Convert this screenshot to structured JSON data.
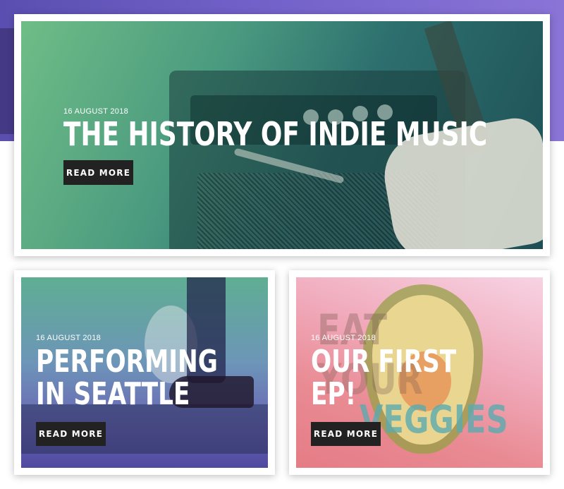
{
  "featured_post": {
    "date": "16 AUGUST 2018",
    "title": "THE HISTORY OF INDIE MUSIC",
    "button_label": "READ MORE"
  },
  "posts": [
    {
      "date": "16 AUGUST 2018",
      "title_line1": "PERFORMING",
      "title_line2": "IN SEATTLE",
      "button_label": "READ MORE"
    },
    {
      "date": "16 AUGUST 2018",
      "title_line1": "OUR FIRST",
      "title_line2": "EP!",
      "button_label": "READ MORE",
      "background_words": [
        "EAT",
        "YOUR",
        "VEGGIES"
      ]
    }
  ],
  "colors": {
    "header_band": "#6f5fc6",
    "button_background": "#222222",
    "text": "#ffffff"
  }
}
